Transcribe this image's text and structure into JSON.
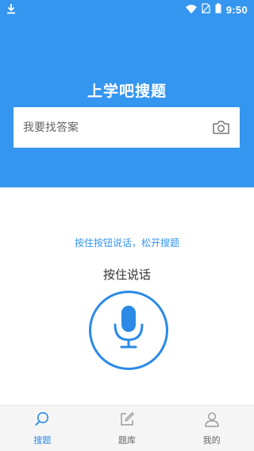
{
  "status_bar": {
    "time": "9:50"
  },
  "header": {
    "title": "上学吧搜题"
  },
  "search": {
    "placeholder": "我要找答案"
  },
  "voice": {
    "hint": "按住按钮说话，松开搜题",
    "title": "按住说话"
  },
  "tabs": [
    {
      "label": "搜题",
      "icon": "search-icon",
      "active": true
    },
    {
      "label": "题库",
      "icon": "edit-icon",
      "active": false
    },
    {
      "label": "我的",
      "icon": "user-icon",
      "active": false
    }
  ],
  "colors": {
    "primary": "#3596f0",
    "accent": "#2b8ae6"
  }
}
